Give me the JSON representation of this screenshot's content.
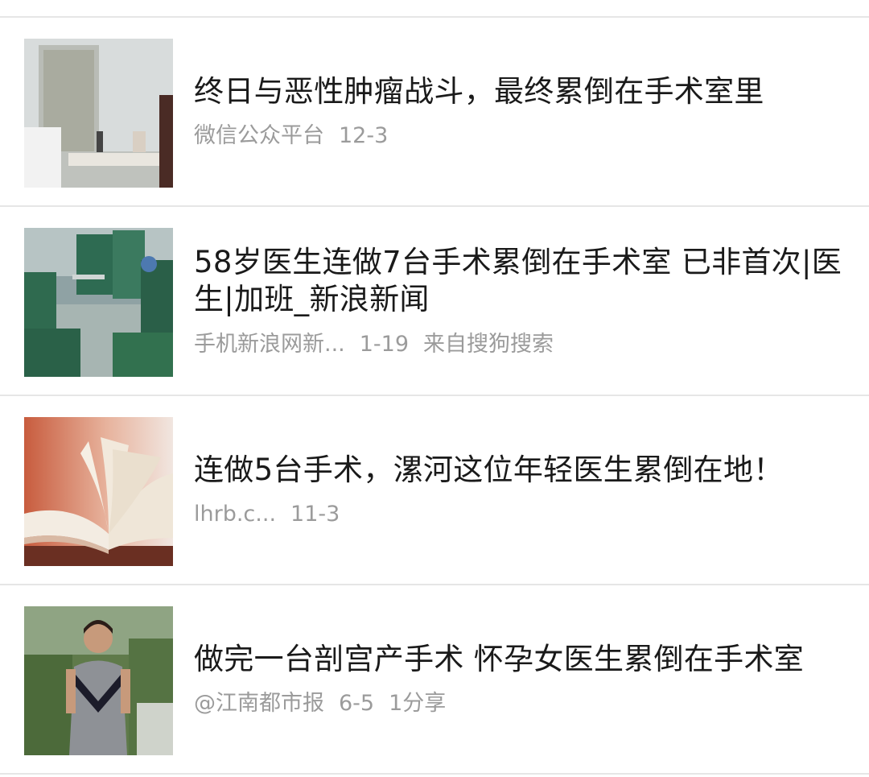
{
  "results": [
    {
      "title": "终日与恶性肿瘤战斗，最终累倒在手术室里",
      "source": "微信公众平台",
      "date": "12-3",
      "extra": "",
      "thumb": "office-photo"
    },
    {
      "title": "58岁医生连做7台手术累倒在手术室 已非首次|医生|加班_新浪新闻",
      "source": "手机新浪网新...",
      "date": "1-19",
      "extra": "来自搜狗搜索",
      "thumb": "operating-room-photo"
    },
    {
      "title": "连做5台手术，漯河这位年轻医生累倒在地！",
      "source": "lhrb.c...",
      "date": "11-3",
      "extra": "",
      "thumb": "open-book-photo"
    },
    {
      "title": "做完一台剖宫产手术 怀孕女医生累倒在手术室",
      "source": "@江南都市报",
      "date": "6-5",
      "extra": "1分享",
      "thumb": "woman-portrait-photo"
    }
  ]
}
